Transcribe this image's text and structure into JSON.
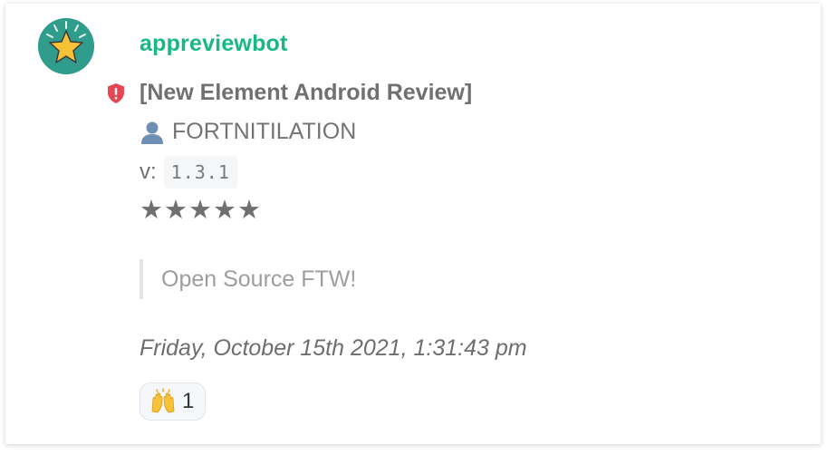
{
  "message": {
    "sender": "appreviewbot",
    "sender_color": "#17b884",
    "avatar_icon": "star-icon",
    "badge_icon": "shield-alert-icon",
    "badge_color": "#e64553",
    "title": "[New Element Android Review]",
    "author_icon": "person-icon",
    "author": "FORTNITILATION",
    "version_label": "v:",
    "version_value": "1.3.1",
    "stars": "★★★★★",
    "rating": 5,
    "review_text": "Open Source FTW!",
    "timestamp": "Friday, October 15th 2021, 1:31:43 pm"
  },
  "reaction": {
    "emoji_icon": "raising-hands-icon",
    "count": "1"
  }
}
